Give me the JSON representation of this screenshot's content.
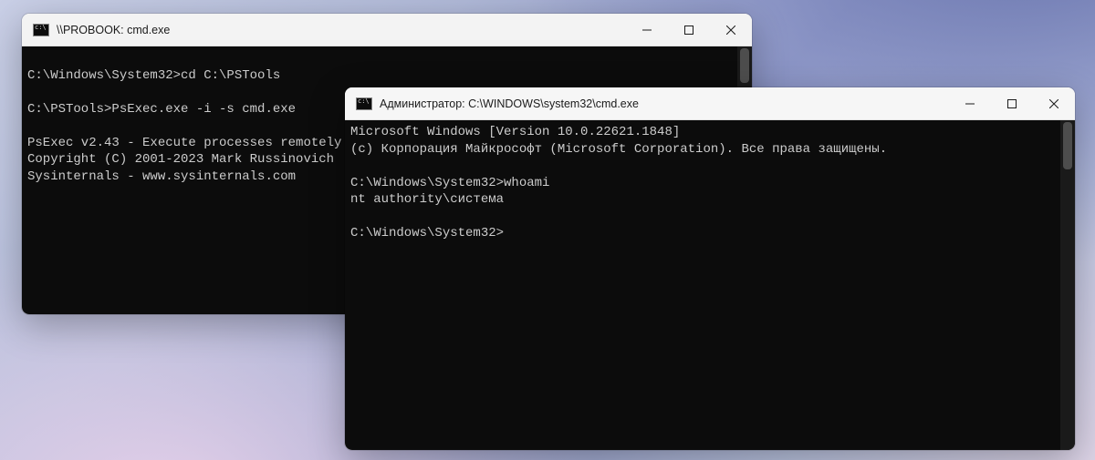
{
  "window_back": {
    "title": "\\\\PROBOOK: cmd.exe",
    "lines": [
      "",
      "C:\\Windows\\System32>cd C:\\PSTools",
      "",
      "C:\\PSTools>PsExec.exe -i -s cmd.exe",
      "",
      "PsExec v2.43 - Execute processes remotely",
      "Copyright (C) 2001-2023 Mark Russinovich",
      "Sysinternals - www.sysinternals.com",
      ""
    ]
  },
  "window_front": {
    "title": "Администратор: C:\\WINDOWS\\system32\\cmd.exe",
    "lines": [
      "Microsoft Windows [Version 10.0.22621.1848]",
      "(c) Корпорация Майкрософт (Microsoft Corporation). Все права защищены.",
      "",
      "C:\\Windows\\System32>whoami",
      "nt authority\\система",
      "",
      "C:\\Windows\\System32>"
    ]
  }
}
